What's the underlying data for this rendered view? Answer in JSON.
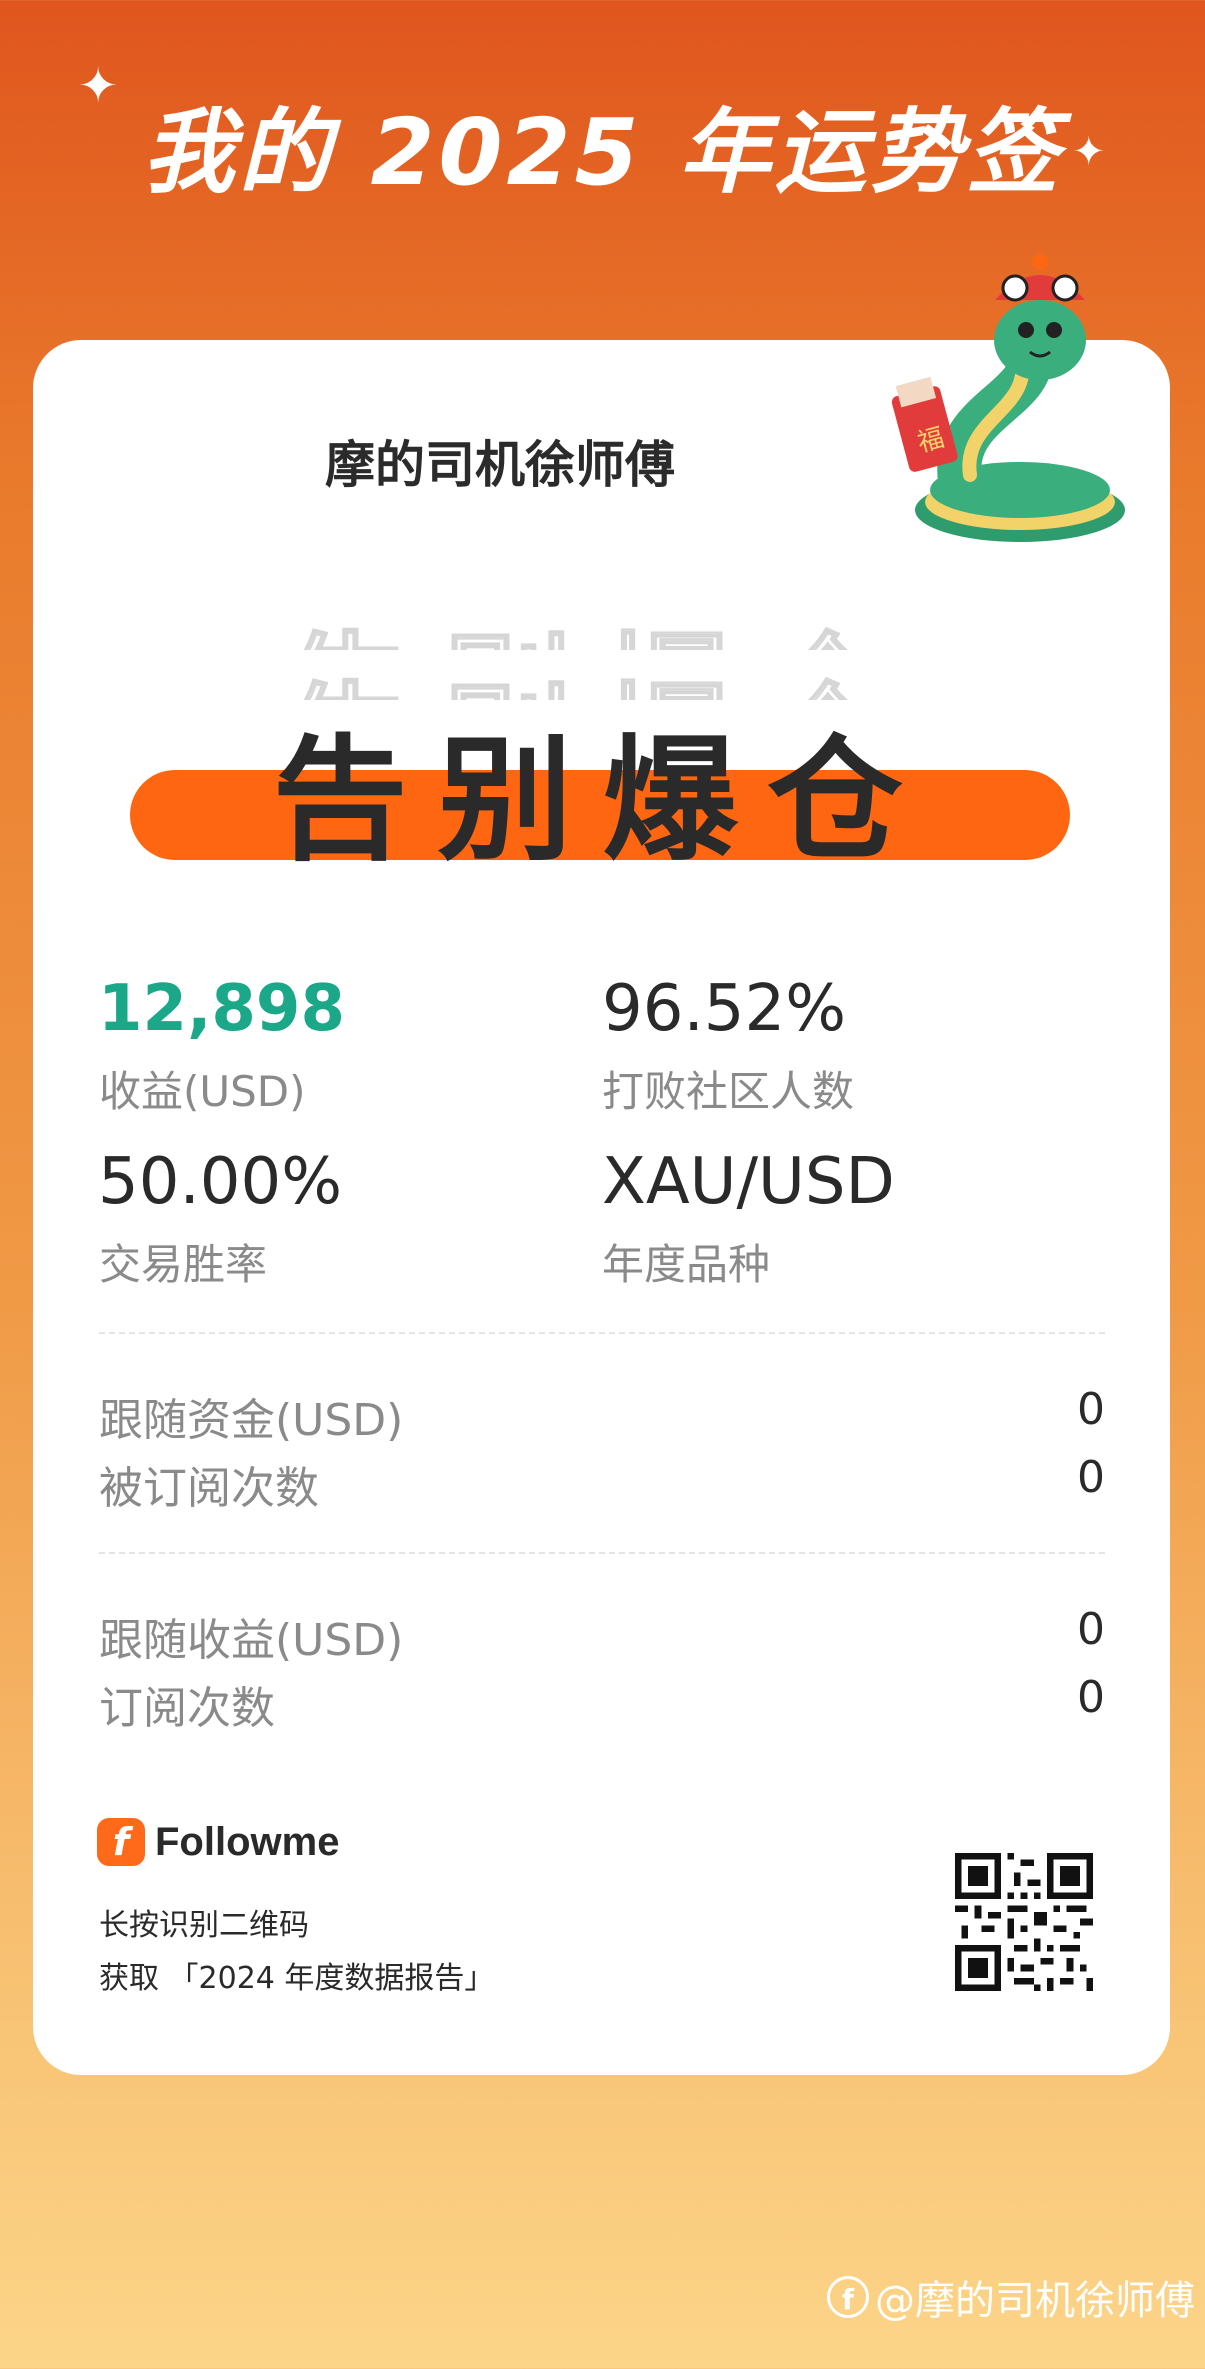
{
  "header": {
    "title": "我的 2025 年运势签"
  },
  "card": {
    "username": "摩的司机徐师傅",
    "slogan": "告别爆仓",
    "stats": {
      "profit_value": "12,898",
      "profit_label": "收益(USD)",
      "beat_value": "96.52%",
      "beat_label": "打败社区人数",
      "winrate_value": "50.00%",
      "winrate_label": "交易胜率",
      "symbol_value": "XAU/USD",
      "symbol_label": "年度品种"
    },
    "follow_rows": [
      {
        "label": "跟随资金(USD)",
        "value": "0"
      },
      {
        "label": "被订阅次数",
        "value": "0"
      }
    ],
    "earn_rows": [
      {
        "label": "跟随收益(USD)",
        "value": "0"
      },
      {
        "label": "订阅次数",
        "value": "0"
      }
    ],
    "brand": {
      "name": "Followme",
      "icon_letter": "f"
    },
    "qr_hint_line1": "长按识别二维码",
    "qr_hint_line2": "获取 「2024 年度数据报告」"
  },
  "mascot": {
    "badge_text": "福"
  },
  "watermark": {
    "icon_letter": "f",
    "text": "@摩的司机徐师傅"
  },
  "colors": {
    "accent": "#ff6611",
    "profit_green": "#1aa888",
    "header_bg": "#e0561e"
  }
}
